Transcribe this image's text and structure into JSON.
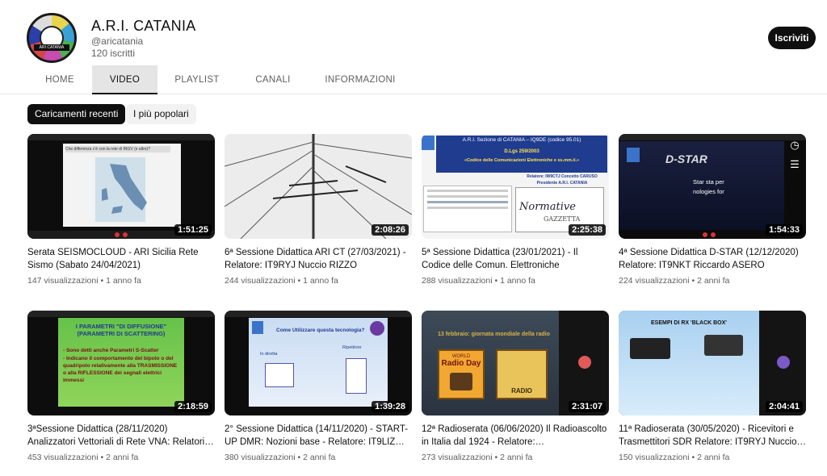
{
  "channel": {
    "name": "A.R.I. CATANIA",
    "handle": "@aricatania",
    "subscribers": "120 iscritti",
    "subscribe_label": "Iscriviti",
    "avatar_text": "ARI CATANIA"
  },
  "tabs": [
    {
      "label": "HOME"
    },
    {
      "label": "VIDEO"
    },
    {
      "label": "PLAYLIST"
    },
    {
      "label": "CANALI"
    },
    {
      "label": "INFORMAZIONI"
    }
  ],
  "active_tab": "VIDEO",
  "chips": [
    {
      "label": "Caricamenti recenti"
    },
    {
      "label": "I più popolari"
    }
  ],
  "videos": [
    {
      "title": "Serata SEISMOCLOUD - ARI Sicilia Rete Sismo (Sabato 24/04/2021)",
      "duration": "1:51:25",
      "views": "147 visualizzazioni",
      "age": "1 anno fa"
    },
    {
      "title": "6ª Sessione Didattica ARI CT (27/03/2021) - Relatore: IT9RYJ Nuccio RIZZO",
      "duration": "2:08:26",
      "views": "244 visualizzazioni",
      "age": "1 anno fa"
    },
    {
      "title": "5ª Sessione Didattica (23/01/2021) - Il Codice delle Comun. Elettroniche Relatore:…",
      "duration": "2:25:38",
      "views": "288 visualizzazioni",
      "age": "1 anno fa"
    },
    {
      "title": "4ª Sessione Didattica D-STAR (12/12/2020) Relatore: IT9NKT Riccardo ASERO",
      "duration": "1:54:33",
      "views": "224 visualizzazioni",
      "age": "2 anni fa"
    },
    {
      "title": "3ªSessione Didattica (28/11/2020) Analizzatori Vettoriali di Rete VNA: Relatori…",
      "duration": "2:18:59",
      "views": "453 visualizzazioni",
      "age": "2 anni fa"
    },
    {
      "title": "2° Sessione Didattica (14/11/2020) - START-UP DMR: Nozioni base - Relatore: IT9LIZ…",
      "duration": "1:39:28",
      "views": "380 visualizzazioni",
      "age": "2 anni fa"
    },
    {
      "title": "12ª Radioserata (06/06/2020) Il Radioascolto in Italia dal 1924 - Relatore:…",
      "duration": "2:31:07",
      "views": "273 visualizzazioni",
      "age": "2 anni fa"
    },
    {
      "title": "11ª Radioserata (30/05/2020) - Ricevitori e Trasmettitori SDR Relatore: IT9RYJ Nuccio…",
      "duration": "2:04:41",
      "views": "150 visualizzazioni",
      "age": "2 anni fa"
    }
  ],
  "thumb_text": {
    "t1_slide": "Che differenza c'è con la rete di INGV (e altre)?",
    "t3_header": "A.R.I. Sezione di CATANIA – IQ9DE (codice 95.01)",
    "t3_law": "D.Lgs 259/2003",
    "t3_code": "«Codice delle Comunicazioni Elettroniche e ss.mm.ii.»",
    "t3_speaker": "Relatore: IW9CTJ Concetto CARUSO",
    "t3_president": "Presidente A.R.I. CATANIA",
    "t3_normative": "Normative",
    "t3_gazzetta": "GAZZETTA",
    "t4_logo": "D-STAR",
    "t4_line1": "Star sta per",
    "t4_line2": "nologies for",
    "t5_title": "I PARAMETRI \"DI DIFFUSIONE\" (PARAMETRI DI SCATTERING)",
    "t5_body1": "- Sono detti anche Parametri S-Scatter",
    "t5_body2": "- Indicano il comportamento del bipolo o del quadripolo relativamente alla TRASMISSIONE o alla RIFLESSIONE dei segnali elettrici immessi",
    "t6_title": "Come Utilizzare questa tecnologia?",
    "t6_direct": "In diretta",
    "t6_repeater": "Ripetitore",
    "t7_banner": "13 febbraio: giornata mondiale della radio",
    "t7_world": "WORLD",
    "t7_radioday": "Radio Day",
    "t7_radio": "RADIO",
    "t8_title": "ESEMPI DI RX 'BLACK BOX'"
  },
  "colors": {
    "accent": "#0f0f0f",
    "meta": "#606060",
    "chip_bg": "#f2f2f2"
  }
}
